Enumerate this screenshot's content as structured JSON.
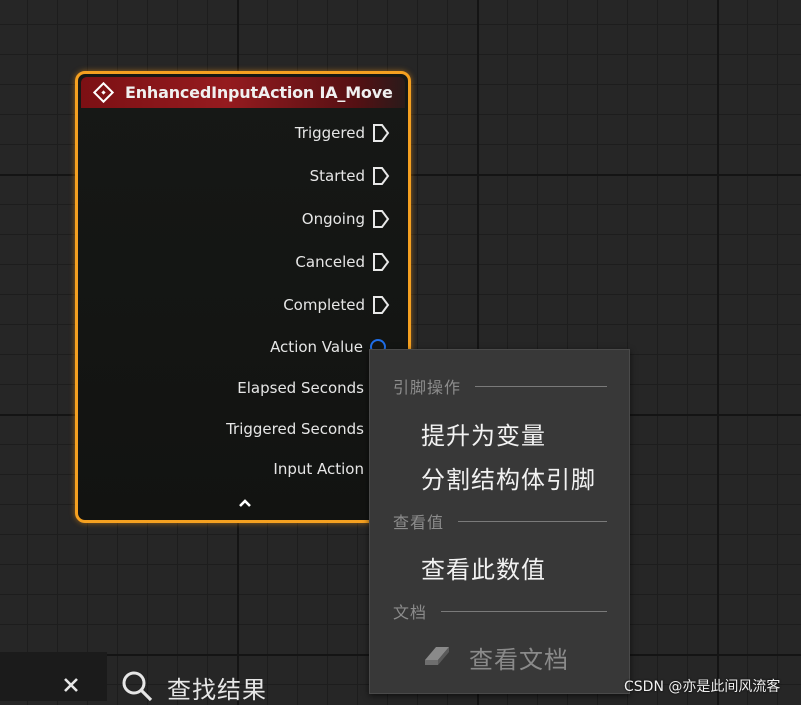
{
  "node": {
    "title": "EnhancedInputAction IA_Move",
    "output_pins": [
      {
        "label": "Triggered",
        "kind": "exec"
      },
      {
        "label": "Started",
        "kind": "exec"
      },
      {
        "label": "Ongoing",
        "kind": "exec"
      },
      {
        "label": "Canceled",
        "kind": "exec"
      },
      {
        "label": "Completed",
        "kind": "exec"
      },
      {
        "label": "Action Value",
        "kind": "struct"
      },
      {
        "label": "Elapsed Seconds",
        "kind": "data"
      },
      {
        "label": "Triggered Seconds",
        "kind": "data"
      },
      {
        "label": "Input Action",
        "kind": "data"
      }
    ],
    "header_color": "#951b1f",
    "border_color": "#f5a020",
    "struct_pin_color": "#1f6ee8"
  },
  "context_menu": {
    "sections": [
      {
        "header": "引脚操作",
        "items": [
          {
            "label": "提升为变量"
          },
          {
            "label": "分割结构体引脚"
          }
        ]
      },
      {
        "header": "查看值",
        "items": [
          {
            "label": "查看此数值"
          }
        ]
      },
      {
        "header": "文档",
        "items": [
          {
            "label": "查看文档",
            "disabled": true,
            "icon": "eraser-icon"
          }
        ]
      }
    ]
  },
  "bottom_bar": {
    "search_results_label": "查找结果"
  },
  "watermark": "CSDN @亦是此间风流客"
}
